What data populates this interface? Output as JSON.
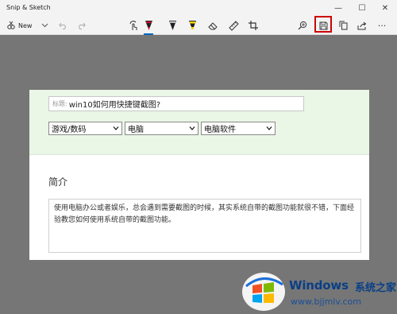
{
  "window": {
    "app_title": "Snip & Sketch",
    "controls": {
      "minimize": "—",
      "maximize": "☐",
      "close": "✕"
    }
  },
  "toolbar": {
    "new_label": "New",
    "items": [
      "new-snip-icon",
      "chevron-down-icon",
      "undo-icon",
      "redo-icon",
      "touch-writing-icon",
      "ballpoint-pen-icon",
      "pencil-icon",
      "highlighter-icon",
      "eraser-icon",
      "ruler-icon",
      "crop-icon",
      "zoom-icon",
      "save-icon",
      "copy-icon",
      "share-icon",
      "more-icon"
    ],
    "more_label": "···",
    "active_tool": "ballpoint-pen-icon",
    "highlighted_button": "save-icon",
    "accent_color": "#0067c0",
    "highlight_color": "#cc0000"
  },
  "captured": {
    "title_prefix": "标题:",
    "title_value": "win10如何用快捷键截图?",
    "selects": [
      "游戏/数码",
      "电脑",
      "电脑软件"
    ],
    "section_title": "简介",
    "description": "使用电脑办公或者娱乐，总会遇到需要截图的时候，其实系统自带的截图功能就很不错，下面经验教您如何使用系统自带的截图功能。"
  },
  "watermark": {
    "brand": "Windows",
    "cn": "系统之家",
    "url": "www.bjjmlv.com"
  }
}
